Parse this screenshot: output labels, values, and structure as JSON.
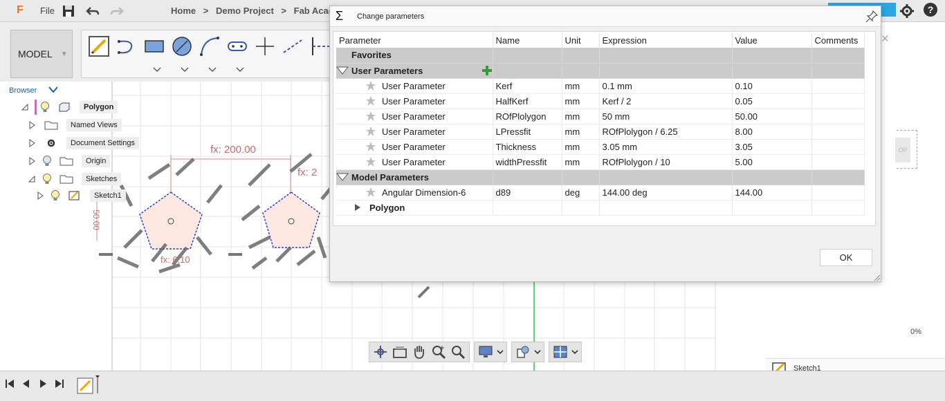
{
  "app": {
    "logo": "F",
    "file_label": "File",
    "breadcrumb": [
      "Home",
      ">",
      "Demo Project",
      ">",
      "Fab Acade"
    ]
  },
  "toolbar": {
    "workspace_label": "MODEL",
    "tools": [
      "create-sketch-icon",
      "arc-icon",
      "rectangle-icon",
      "circle-icon",
      "spline-icon",
      "slot-icon",
      "point-icon",
      "construction-line-icon",
      "trim-icon"
    ]
  },
  "browser": {
    "label": "Browser",
    "items": [
      {
        "label": "Polygon"
      },
      {
        "label": "Named Views"
      },
      {
        "label": "Document Settings"
      },
      {
        "label": "Origin"
      },
      {
        "label": "Sketches"
      },
      {
        "label": "Sketch1"
      }
    ]
  },
  "canvas": {
    "dim_label_1": "fx: 200.00",
    "dim_label_2": "fx: 2",
    "dim_label_3": "50.00",
    "dim_label_4": "fx: 6.10",
    "zoom_percent": "0%",
    "viewcube_face": "OP",
    "sketch_tab": "Sketch1"
  },
  "dialog": {
    "title": "Change parameters",
    "ok_label": "OK",
    "columns": [
      "Parameter",
      "Name",
      "Unit",
      "Expression",
      "Value",
      "Comments"
    ],
    "favorites_label": "Favorites",
    "user_group": {
      "label": "User Parameters",
      "rows": [
        {
          "param": "User Parameter",
          "name": "Kerf",
          "unit": "mm",
          "expression": "0.1 mm",
          "value": "0.10",
          "comments": ""
        },
        {
          "param": "User Parameter",
          "name": "HalfKerf",
          "unit": "mm",
          "expression": "Kerf / 2",
          "value": "0.05",
          "comments": ""
        },
        {
          "param": "User Parameter",
          "name": "ROfPlolygon",
          "unit": "mm",
          "expression": "50 mm",
          "value": "50.00",
          "comments": ""
        },
        {
          "param": "User Parameter",
          "name": "LPressfit",
          "unit": "mm",
          "expression": "ROfPlolygon / 6.25",
          "value": "8.00",
          "comments": ""
        },
        {
          "param": "User Parameter",
          "name": "Thickness",
          "unit": "mm",
          "expression": "3.05 mm",
          "value": "3.05",
          "comments": ""
        },
        {
          "param": "User Parameter",
          "name": "widthPressfit",
          "unit": "mm",
          "expression": "ROfPlolygon / 10",
          "value": "5.00",
          "comments": ""
        }
      ]
    },
    "model_group": {
      "label": "Model Parameters",
      "rows": [
        {
          "param": "Angular Dimension-6",
          "name": "d89",
          "unit": "deg",
          "expression": "144.00 deg",
          "value": "144.00",
          "comments": ""
        }
      ],
      "sub_group": "Polygon"
    }
  }
}
